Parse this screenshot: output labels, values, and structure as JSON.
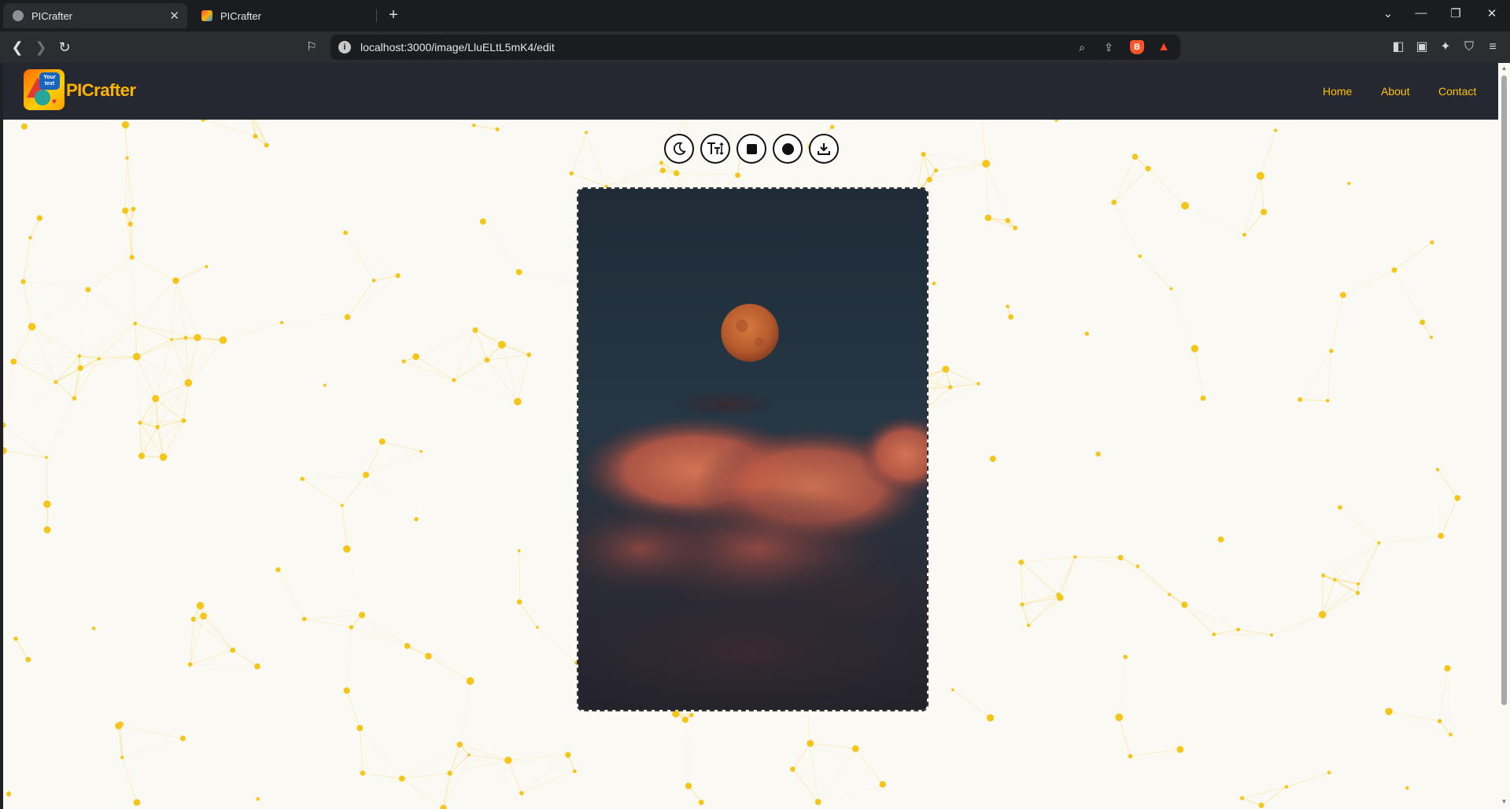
{
  "browser": {
    "tabs": [
      {
        "title": "PICrafter",
        "active": true
      },
      {
        "title": "PICrafter",
        "active": false
      }
    ],
    "url": "localhost:3000/image/LluELtL5mK4/edit",
    "icons": {
      "back": "arrow-left-icon",
      "forward": "arrow-right-icon",
      "reload": "reload-icon",
      "bookmark": "bookmark-icon",
      "zoom": "zoom-icon",
      "share": "share-icon",
      "brave_shields": "brave-shield-icon",
      "rewards": "bat-rewards-icon",
      "sidebar": "sidebar-icon",
      "wallet": "wallet-icon",
      "leo": "ai-assistant-icon",
      "vpn": "vpn-icon",
      "menu": "hamburger-menu-icon"
    }
  },
  "site": {
    "brand": "PICrafter",
    "logo_text": "Your text",
    "nav": {
      "home": "Home",
      "about": "About",
      "contact": "Contact"
    },
    "accent_color": "#ffc107",
    "nav_bg": "#252830"
  },
  "editor": {
    "tools": [
      {
        "name": "dark-mode-tool",
        "icon": "moon-icon"
      },
      {
        "name": "text-size-tool",
        "icon": "text-height-icon"
      },
      {
        "name": "square-shape-tool",
        "icon": "square-icon"
      },
      {
        "name": "circle-shape-tool",
        "icon": "circle-icon"
      },
      {
        "name": "download-tool",
        "icon": "download-icon"
      }
    ],
    "image_subject": "full moon over orange clouds at dusk"
  }
}
